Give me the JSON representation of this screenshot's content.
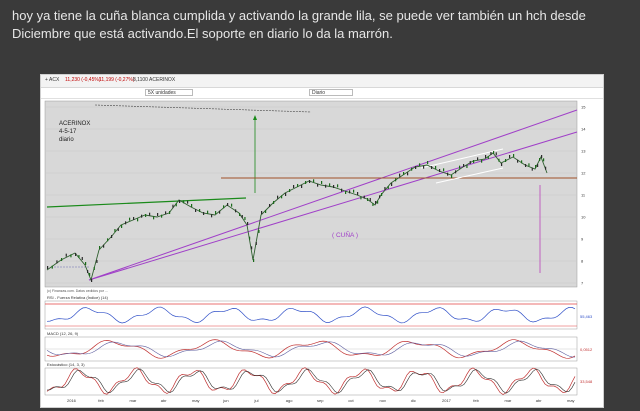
{
  "post": {
    "text": "hoy ya tiene la cuña blanca cumplida y activando la grande lila, se puede ver también un hch desde Diciembre que está activando.El soporte en diario lo da la marrón."
  },
  "toolbar": {
    "items": [
      "+ ACX",
      "11,230 (-0,45%)",
      "11,199 (-0,27%)",
      "8,1100 ACERINOX"
    ],
    "period_select": "5X unidades",
    "timeframe_select": "Diario"
  },
  "chart": {
    "ticker": "ACERINOX",
    "date": "4-5-17",
    "timeframe": "diario",
    "pattern_label": "( CUÑA )",
    "credit": "(c) Finanzas.com. Datos cedidos por ...",
    "panels": [
      {
        "label": "RSI - Fuerza Relativa (Índice) (14)",
        "value": "55,463"
      },
      {
        "label": "MACD (12, 26, 9)",
        "value": "0,0512"
      },
      {
        "label": "Estocástico (14, 3, 3)",
        "value": "33,548"
      }
    ],
    "x_labels": [
      "2016",
      "feb",
      "mar",
      "abr",
      "may",
      "jun",
      "jul",
      "ago",
      "sep",
      "oct",
      "nov",
      "dic",
      "2017",
      "feb",
      "mar",
      "abr",
      "may"
    ],
    "y_labels": [
      "15",
      "14",
      "13",
      "12",
      "11",
      "10",
      "9",
      "8",
      "7"
    ],
    "colors": {
      "wedge_large": "#a040c8",
      "wedge_small": "#ffffff",
      "support_brown": "#a05028",
      "green_line": "#1a8a1a",
      "price": "#2f5f2f",
      "background": "#d8d8d8"
    }
  }
}
